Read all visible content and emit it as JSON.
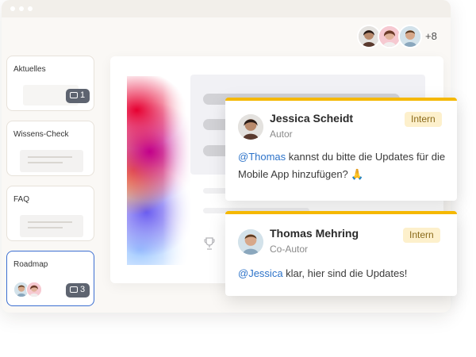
{
  "collaborators": {
    "more_count": "+8"
  },
  "pages": [
    {
      "label": "Aktuelles",
      "comment_count": "1"
    },
    {
      "label": "Wissens-Check"
    },
    {
      "label": "FAQ"
    },
    {
      "label": "Roadmap",
      "comment_count": "3"
    }
  ],
  "comments": [
    {
      "author": "Jessica Scheidt",
      "role": "Autor",
      "tag": "Intern",
      "mention": "@Thomas",
      "message": " kannst du bitte die Updates für die Mobile App hinzufügen? 🙏"
    },
    {
      "author": "Thomas Mehring",
      "role": "Co-Autor",
      "tag": "Intern",
      "mention": "@Jessica",
      "message": " klar, hier sind die Updates!"
    }
  ],
  "colors": {
    "accent": "#f5b800",
    "mention": "#2d73c9",
    "active_border": "#3c6fd1",
    "badge": "#5e6470"
  }
}
